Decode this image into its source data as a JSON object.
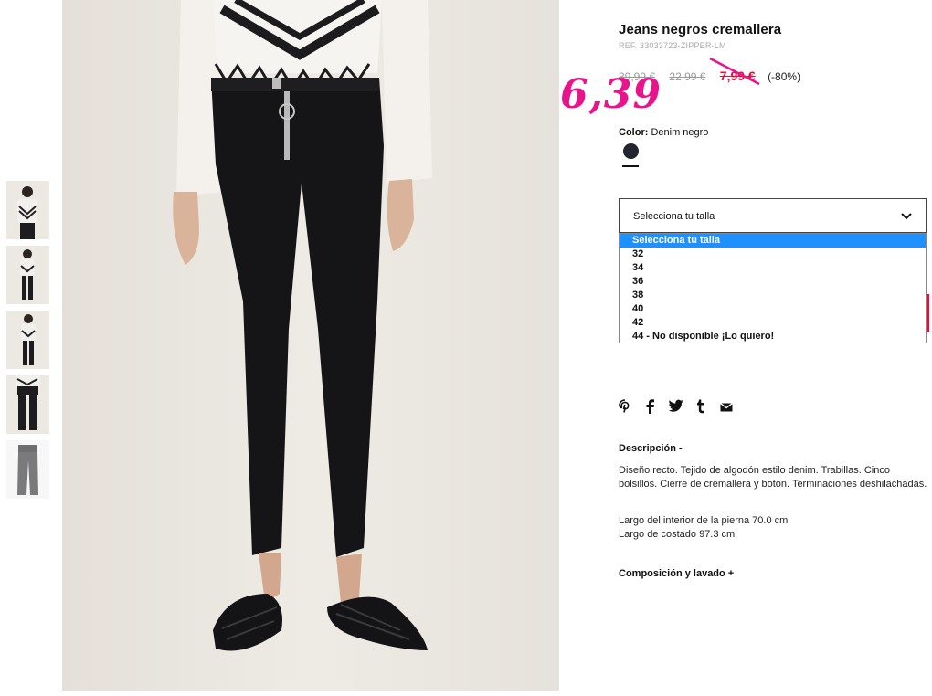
{
  "product": {
    "title": "Jeans negros cremallera",
    "ref": "REF. 33033723-ZIPPER-LM",
    "price_original": "39,99 €",
    "price_previous": "22,99 €",
    "price_sale": "7,99 €",
    "discount": "(-80%)",
    "handwritten_price": "6,39"
  },
  "color": {
    "label": "Color:",
    "value": "Denim negro",
    "swatch_hex": "#22252f"
  },
  "size_select": {
    "current": "Selecciona tu talla",
    "options": [
      "Selecciona tu talla",
      "32",
      "34",
      "36",
      "38",
      "40",
      "42",
      "44 - No disponible ¡Lo quiero!"
    ]
  },
  "social_icons": [
    "pinterest-icon",
    "facebook-icon",
    "twitter-icon",
    "tumblr-icon",
    "email-icon"
  ],
  "description": {
    "title": "Descripción -",
    "text": "Diseño recto. Tejido de algodón estilo denim. Trabillas. Cinco bolsillos. Cierre de cremallera y botón. Terminaciones deshilachadas.",
    "inseam": "Largo del interior de la pierna 70.0 cm",
    "side_length": "Largo de costado 97.3 cm"
  },
  "composition": {
    "label": "Composición y lavado +"
  },
  "colors": {
    "sale_red": "#e0103c",
    "handwritten_pink": "#e8148c",
    "dropdown_highlight": "#1e90ff"
  }
}
